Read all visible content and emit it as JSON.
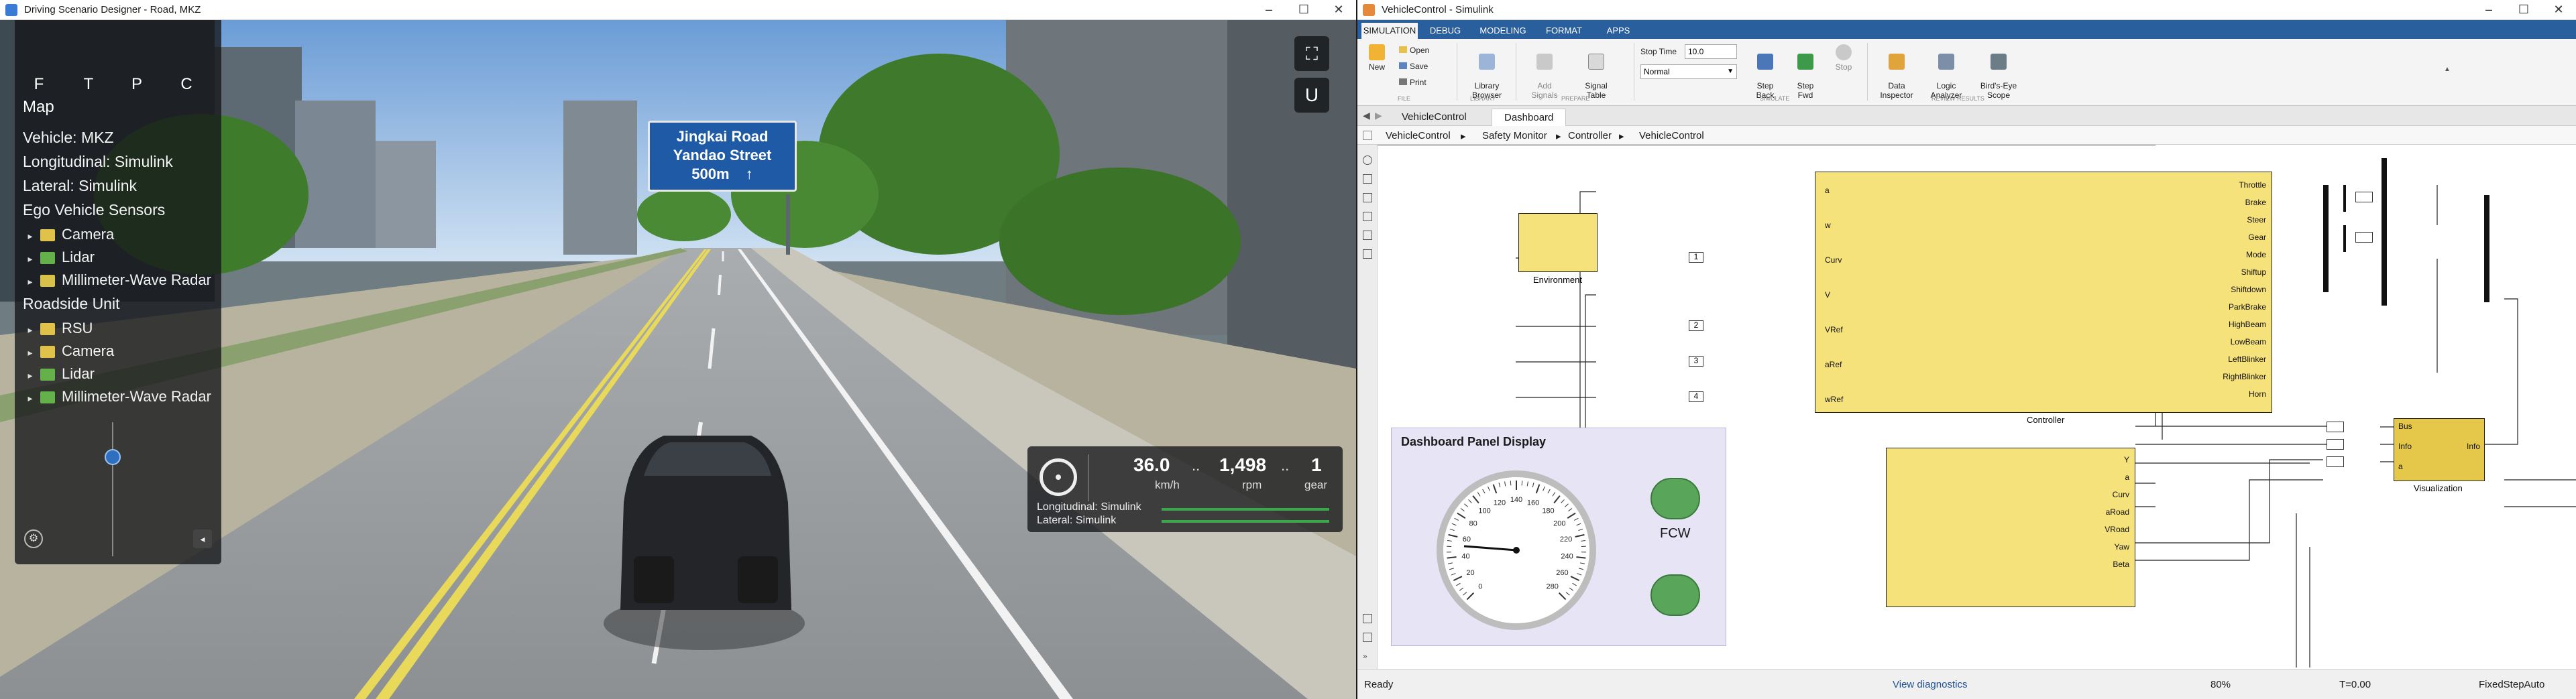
{
  "left_window": {
    "title": "Driving Scenario Designer - Road, MKZ",
    "controls": {
      "minimize": "–",
      "maximize": "☐",
      "close": "✕"
    },
    "view_modes": [
      "F",
      "T",
      "P",
      "C"
    ],
    "panel": {
      "map_label": "Map",
      "vehicle": "Vehicle: MKZ",
      "longitudinal": "Longitudinal: Simulink",
      "lateral": "Lateral: Simulink",
      "ego_sensors_header": "Ego Vehicle Sensors",
      "ego_sensors": [
        "Camera",
        "Lidar",
        "Millimeter-Wave Radar"
      ],
      "roadside_header": "Roadside Unit",
      "roadside_items": [
        "RSU",
        "Camera",
        "Lidar",
        "Millimeter-Wave Radar"
      ]
    },
    "road_sign": {
      "line1": "Jingkai Road",
      "line2": "Yandao Street",
      "line3": "500m",
      "arrow": "↑"
    },
    "hud": {
      "speed_value": "36.0",
      "speed_unit": "km/h",
      "rpm_value": "1,498",
      "rpm_unit": "rpm",
      "gear_value": "1",
      "gear_unit": "gear",
      "longitudinal": "Longitudinal: Simulink",
      "lateral": "Lateral: Simulink"
    }
  },
  "right_window": {
    "title": "VehicleControl - Simulink",
    "controls": {
      "minimize": "–",
      "maximize": "☐",
      "close": "✕"
    },
    "tabs": [
      "SIMULATION",
      "DEBUG",
      "MODELING",
      "FORMAT",
      "APPS"
    ],
    "ribbon": {
      "new_label": "New",
      "open_label": "Open",
      "save_label": "Save",
      "print_label": "Print",
      "library_browser": "Library\nBrowser",
      "add_signals": "Add\nSignals",
      "signal_table": "Signal\nTable",
      "stop_time_label": "Stop Time",
      "stop_time_value": "10.0",
      "mode_value": "Normal",
      "step_back": "Step\nBack",
      "step_forward": "Step\nFwd",
      "stop": "Stop",
      "data_inspector": "Data\nInspector",
      "logic_analyzer": "Logic\nAnalyzer",
      "birds_eye_scope": "Bird's-Eye\nScope",
      "groups": [
        "FILE",
        "LIBRARY",
        "PREPARE",
        "SIMULATE",
        "REVIEW RESULTS"
      ]
    },
    "doc_tabs": [
      "VehicleControl",
      "Dashboard"
    ],
    "breadcrumb": [
      "VehicleControl",
      "Safety Monitor",
      "Controller",
      "VehicleControl"
    ],
    "canvas": {
      "environment_label": "Environment",
      "controller_label": "Controller",
      "controller_inputs": [
        "a",
        "w",
        "Curv",
        "V",
        "VRef",
        "aRef",
        "wRef"
      ],
      "controller_outputs": [
        "Throttle",
        "Brake",
        "Steer",
        "Gear",
        "Mode",
        "Shiftup",
        "Shiftdown",
        "ParkBrake",
        "HighBeam",
        "LowBeam",
        "LeftBlinker",
        "RightBlinker",
        "Horn"
      ],
      "inports": [
        "1",
        "2",
        "3",
        "4"
      ],
      "lower_block_ports": [
        "Y",
        "a",
        "Curv",
        "aRoad",
        "VRoad",
        "Yaw",
        "Beta"
      ],
      "visualization_label": "Visualization",
      "visualization_ports": [
        "Bus",
        "Info",
        "a"
      ],
      "visualization_output": "Info",
      "dashboard_title": "Dashboard Panel Display",
      "fcw_label": "FCW",
      "gauge_ticks": [
        "0",
        "20",
        "40",
        "60",
        "80",
        "100",
        "120",
        "140",
        "160",
        "180",
        "200",
        "220",
        "240",
        "260",
        "280"
      ]
    },
    "status": {
      "ready": "Ready",
      "diagnostics": "View diagnostics",
      "zoom": "80%",
      "time": "T=0.00",
      "solver": "FixedStepAuto"
    }
  }
}
